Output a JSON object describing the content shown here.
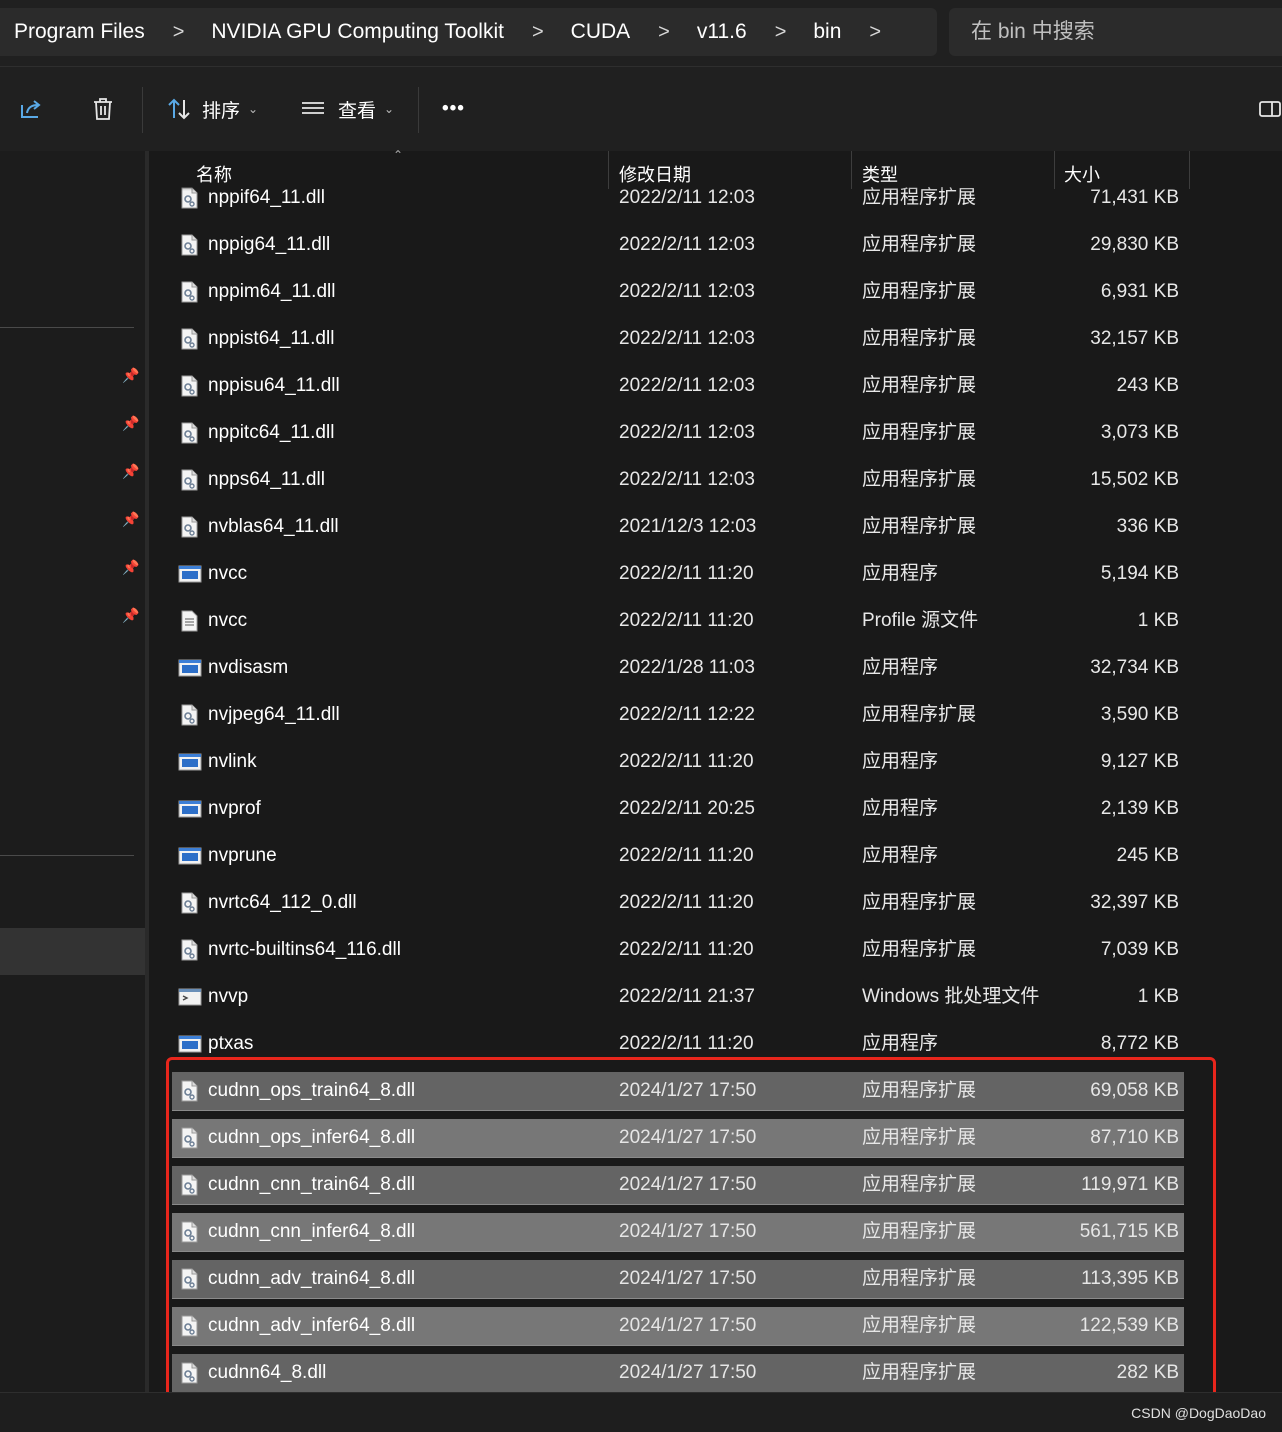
{
  "breadcrumb": [
    "Program Files",
    "NVIDIA GPU Computing Toolkit",
    "CUDA",
    "v11.6",
    "bin"
  ],
  "breadcrumb_separator": ">",
  "search": {
    "placeholder": "在 bin 中搜索"
  },
  "toolbar": {
    "share_icon": "share-icon",
    "delete_icon": "trash-icon",
    "sort_label": "排序",
    "view_label": "查看",
    "more_label": "•••",
    "details_pane_icon": "details-pane-icon"
  },
  "columns": {
    "name": "名称",
    "date": "修改日期",
    "type": "类型",
    "size": "大小"
  },
  "files": [
    {
      "name": "nppif64_11.dll",
      "date": "2022/2/11 12:03",
      "type": "应用程序扩展",
      "size": "71,431 KB",
      "icon": "dll-icon",
      "selected": false
    },
    {
      "name": "nppig64_11.dll",
      "date": "2022/2/11 12:03",
      "type": "应用程序扩展",
      "size": "29,830 KB",
      "icon": "dll-icon",
      "selected": false
    },
    {
      "name": "nppim64_11.dll",
      "date": "2022/2/11 12:03",
      "type": "应用程序扩展",
      "size": "6,931 KB",
      "icon": "dll-icon",
      "selected": false
    },
    {
      "name": "nppist64_11.dll",
      "date": "2022/2/11 12:03",
      "type": "应用程序扩展",
      "size": "32,157 KB",
      "icon": "dll-icon",
      "selected": false
    },
    {
      "name": "nppisu64_11.dll",
      "date": "2022/2/11 12:03",
      "type": "应用程序扩展",
      "size": "243 KB",
      "icon": "dll-icon",
      "selected": false
    },
    {
      "name": "nppitc64_11.dll",
      "date": "2022/2/11 12:03",
      "type": "应用程序扩展",
      "size": "3,073 KB",
      "icon": "dll-icon",
      "selected": false
    },
    {
      "name": "npps64_11.dll",
      "date": "2022/2/11 12:03",
      "type": "应用程序扩展",
      "size": "15,502 KB",
      "icon": "dll-icon",
      "selected": false
    },
    {
      "name": "nvblas64_11.dll",
      "date": "2021/12/3 12:03",
      "type": "应用程序扩展",
      "size": "336 KB",
      "icon": "dll-icon",
      "selected": false
    },
    {
      "name": "nvcc",
      "date": "2022/2/11 11:20",
      "type": "应用程序",
      "size": "5,194 KB",
      "icon": "exe-icon",
      "selected": false
    },
    {
      "name": "nvcc",
      "date": "2022/2/11 11:20",
      "type": "Profile 源文件",
      "size": "1 KB",
      "icon": "text-file-icon",
      "selected": false
    },
    {
      "name": "nvdisasm",
      "date": "2022/1/28 11:03",
      "type": "应用程序",
      "size": "32,734 KB",
      "icon": "exe-icon",
      "selected": false
    },
    {
      "name": "nvjpeg64_11.dll",
      "date": "2022/2/11 12:22",
      "type": "应用程序扩展",
      "size": "3,590 KB",
      "icon": "dll-icon",
      "selected": false
    },
    {
      "name": "nvlink",
      "date": "2022/2/11 11:20",
      "type": "应用程序",
      "size": "9,127 KB",
      "icon": "exe-icon",
      "selected": false
    },
    {
      "name": "nvprof",
      "date": "2022/2/11 20:25",
      "type": "应用程序",
      "size": "2,139 KB",
      "icon": "exe-icon",
      "selected": false
    },
    {
      "name": "nvprune",
      "date": "2022/2/11 11:20",
      "type": "应用程序",
      "size": "245 KB",
      "icon": "exe-icon",
      "selected": false
    },
    {
      "name": "nvrtc64_112_0.dll",
      "date": "2022/2/11 11:20",
      "type": "应用程序扩展",
      "size": "32,397 KB",
      "icon": "dll-icon",
      "selected": false
    },
    {
      "name": "nvrtc-builtins64_116.dll",
      "date": "2022/2/11 11:20",
      "type": "应用程序扩展",
      "size": "7,039 KB",
      "icon": "dll-icon",
      "selected": false
    },
    {
      "name": "nvvp",
      "date": "2022/2/11 21:37",
      "type": "Windows 批处理文件",
      "size": "1 KB",
      "icon": "batch-file-icon",
      "selected": false
    },
    {
      "name": "ptxas",
      "date": "2022/2/11 11:20",
      "type": "应用程序",
      "size": "8,772 KB",
      "icon": "exe-icon",
      "selected": false
    },
    {
      "name": "cudnn_ops_train64_8.dll",
      "date": "2024/1/27 17:50",
      "type": "应用程序扩展",
      "size": "69,058 KB",
      "icon": "dll-icon",
      "selected": true
    },
    {
      "name": "cudnn_ops_infer64_8.dll",
      "date": "2024/1/27 17:50",
      "type": "应用程序扩展",
      "size": "87,710 KB",
      "icon": "dll-icon",
      "selected": true
    },
    {
      "name": "cudnn_cnn_train64_8.dll",
      "date": "2024/1/27 17:50",
      "type": "应用程序扩展",
      "size": "119,971 KB",
      "icon": "dll-icon",
      "selected": true
    },
    {
      "name": "cudnn_cnn_infer64_8.dll",
      "date": "2024/1/27 17:50",
      "type": "应用程序扩展",
      "size": "561,715 KB",
      "icon": "dll-icon",
      "selected": true
    },
    {
      "name": "cudnn_adv_train64_8.dll",
      "date": "2024/1/27 17:50",
      "type": "应用程序扩展",
      "size": "113,395 KB",
      "icon": "dll-icon",
      "selected": true
    },
    {
      "name": "cudnn_adv_infer64_8.dll",
      "date": "2024/1/27 17:50",
      "type": "应用程序扩展",
      "size": "122,539 KB",
      "icon": "dll-icon",
      "selected": true
    },
    {
      "name": "cudnn64_8.dll",
      "date": "2024/1/27 17:50",
      "type": "应用程序扩展",
      "size": "282 KB",
      "icon": "dll-icon",
      "selected": true
    }
  ],
  "annotation": {
    "color": "#e8261c"
  },
  "watermark": "CSDN @DogDaoDao",
  "colors": {
    "background": "#191919",
    "selected_row": "#777777",
    "accent": "#4ca0e0"
  }
}
